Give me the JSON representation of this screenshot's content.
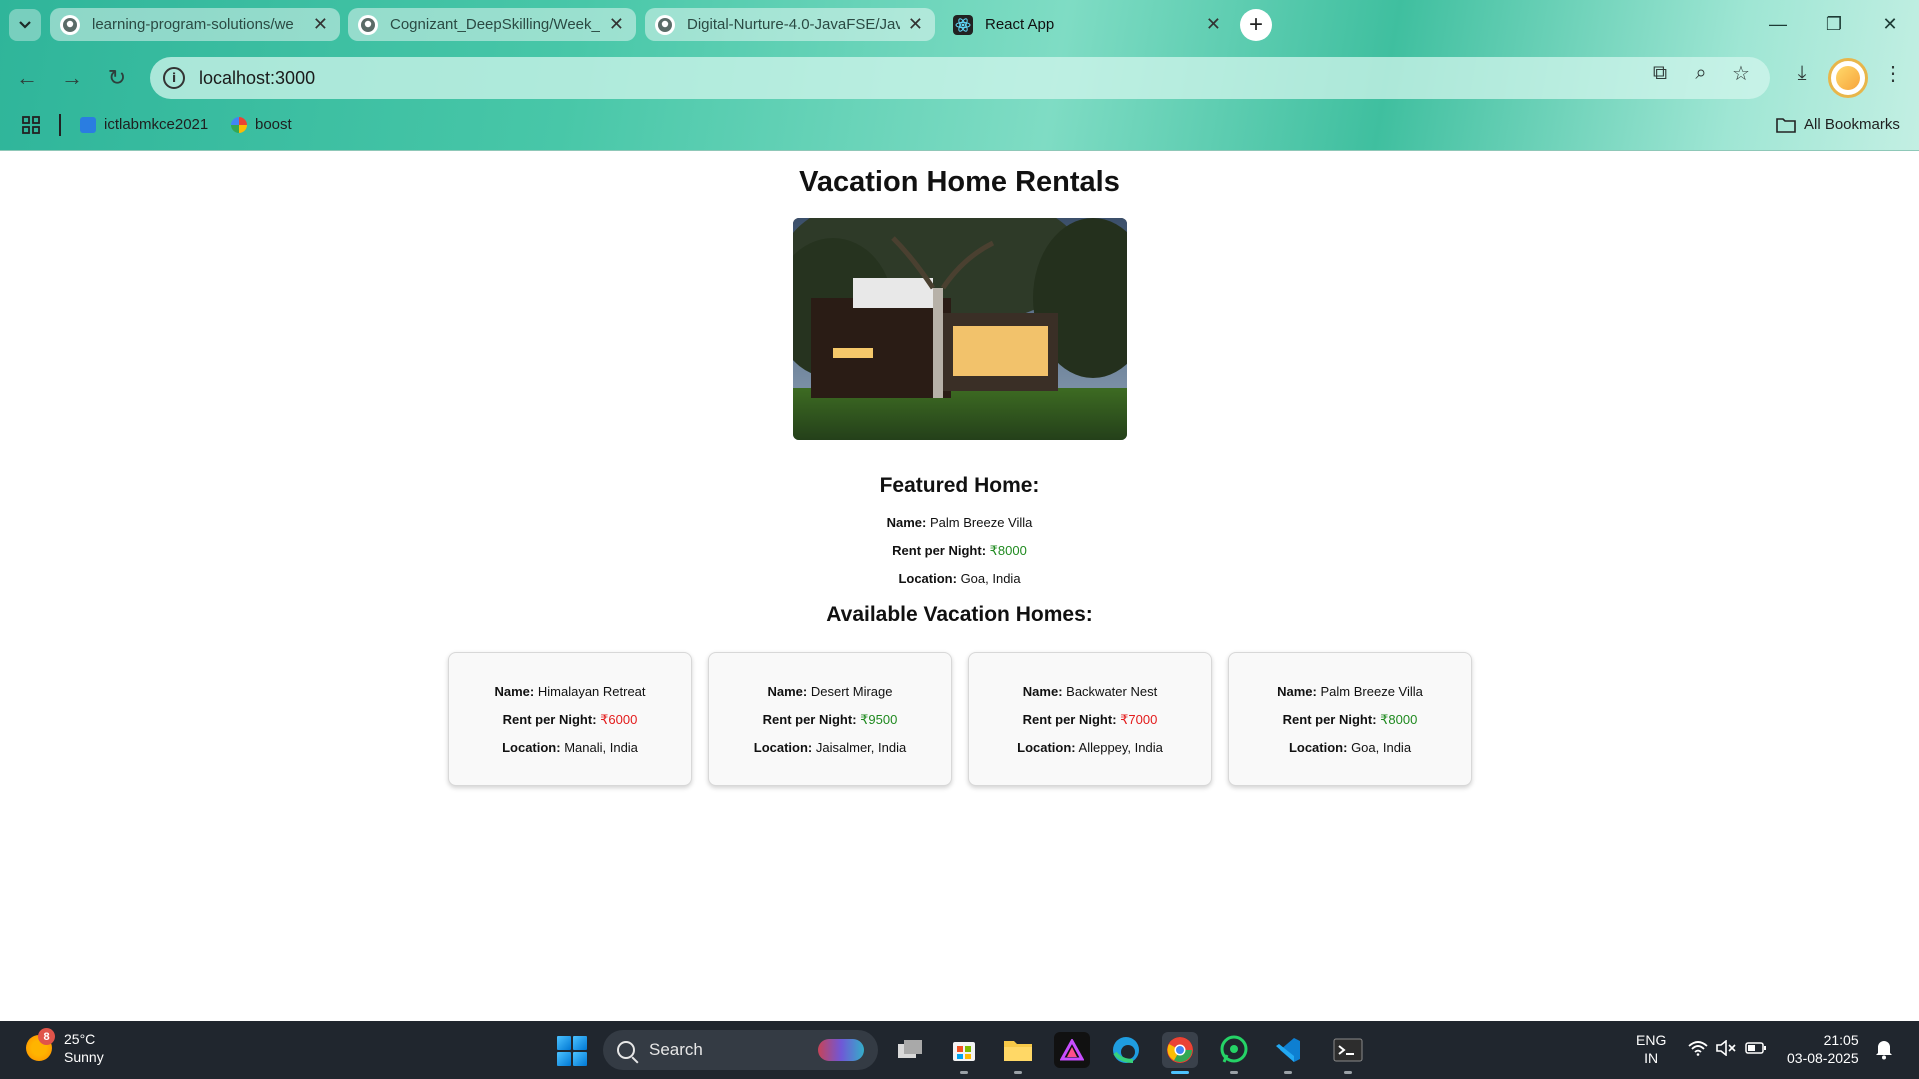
{
  "browser": {
    "tabs": [
      {
        "title": "learning-program-solutions/we",
        "icon": "github-icon",
        "active": false
      },
      {
        "title": "Cognizant_DeepSkilling/Week_",
        "icon": "github-icon",
        "active": false
      },
      {
        "title": "Digital-Nurture-4.0-JavaFSE/Jav",
        "icon": "github-icon",
        "active": false
      },
      {
        "title": "React App",
        "icon": "react-icon",
        "active": true
      }
    ],
    "url": "localhost:3000",
    "bookmarks": [
      {
        "label": "ictlabmkce2021",
        "icon": "code-icon"
      },
      {
        "label": "boost",
        "icon": "google-icon"
      }
    ],
    "all_bookmarks_label": "All Bookmarks"
  },
  "page": {
    "title": "Vacation Home Rentals",
    "featured_heading": "Featured Home:",
    "featured": {
      "name_label": "Name:",
      "name": "Palm Breeze Villa",
      "rent_label": "Rent per Night:",
      "rent": "₹8000",
      "rent_color": "#1f8a1f",
      "location_label": "Location:",
      "location": "Goa, India"
    },
    "available_heading": "Available Vacation Homes:",
    "homes": [
      {
        "name_label": "Name:",
        "name": "Himalayan Retreat",
        "rent_label": "Rent per Night:",
        "rent": "₹6000",
        "rent_color": "#e31b1b",
        "location_label": "Location:",
        "location": "Manali, India"
      },
      {
        "name_label": "Name:",
        "name": "Desert Mirage",
        "rent_label": "Rent per Night:",
        "rent": "₹9500",
        "rent_color": "#1f8a1f",
        "location_label": "Location:",
        "location": "Jaisalmer, India"
      },
      {
        "name_label": "Name:",
        "name": "Backwater Nest",
        "rent_label": "Rent per Night:",
        "rent": "₹7000",
        "rent_color": "#e31b1b",
        "location_label": "Location:",
        "location": "Alleppey, India"
      },
      {
        "name_label": "Name:",
        "name": "Palm Breeze Villa",
        "rent_label": "Rent per Night:",
        "rent": "₹8000",
        "rent_color": "#1f8a1f",
        "location_label": "Location:",
        "location": "Goa, India"
      }
    ]
  },
  "taskbar": {
    "weather": {
      "badge": "8",
      "temp": "25°C",
      "condition": "Sunny"
    },
    "search_placeholder": "Search",
    "language": {
      "line1": "ENG",
      "line2": "IN"
    },
    "clock": {
      "time": "21:05",
      "date": "03-08-2025"
    }
  }
}
